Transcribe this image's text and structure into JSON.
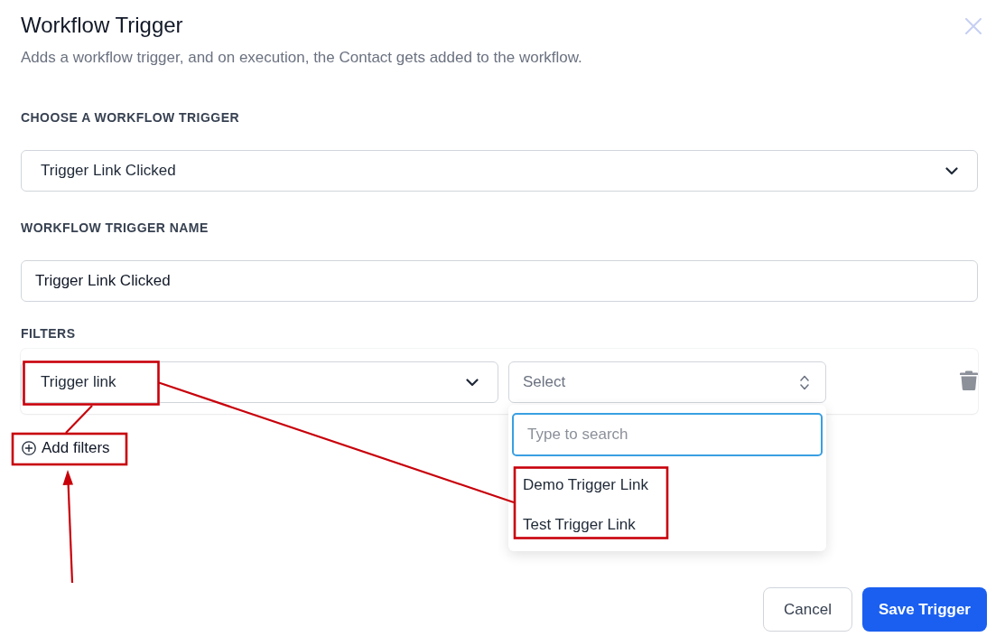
{
  "dialog": {
    "title": "Workflow Trigger",
    "subtitle": "Adds a workflow trigger, and on execution, the Contact gets added to the workflow."
  },
  "trigger_type": {
    "label": "CHOOSE A WORKFLOW TRIGGER",
    "value": "Trigger Link Clicked"
  },
  "trigger_name": {
    "label": "WORKFLOW TRIGGER NAME",
    "value": "Trigger Link Clicked"
  },
  "filters": {
    "label": "FILTERS",
    "rows": [
      {
        "field": "Trigger link",
        "value": {
          "placeholder": "Select",
          "expanded": true,
          "search_placeholder": "Type to search",
          "options": [
            {
              "label": "Demo Trigger Link",
              "selected": false
            },
            {
              "label": "Test Trigger Link",
              "selected": false
            }
          ]
        }
      }
    ],
    "add_button": "Add filters"
  },
  "buttons": [
    {
      "label": "Cancel",
      "kind": "secondary"
    },
    {
      "label": "Save Trigger",
      "kind": "primary"
    }
  ]
}
